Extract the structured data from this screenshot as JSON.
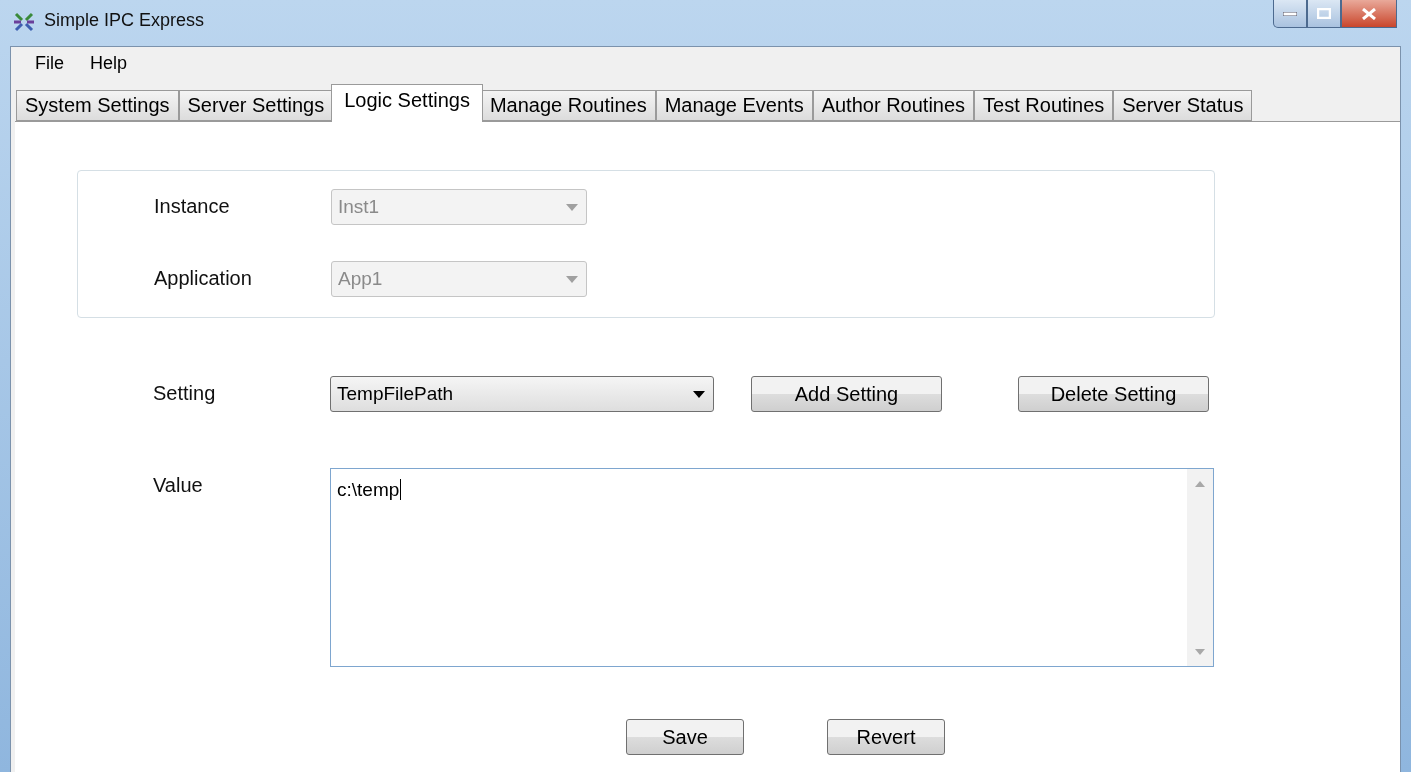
{
  "window": {
    "title": "Simple IPC Express"
  },
  "menu": [
    "File",
    "Help"
  ],
  "tabs": [
    {
      "label": "System Settings",
      "selected": false
    },
    {
      "label": "Server Settings",
      "selected": false
    },
    {
      "label": "Logic Settings",
      "selected": true
    },
    {
      "label": "Manage Routines",
      "selected": false
    },
    {
      "label": "Manage Events",
      "selected": false
    },
    {
      "label": "Author Routines",
      "selected": false
    },
    {
      "label": "Test Routines",
      "selected": false
    },
    {
      "label": "Server Status",
      "selected": false
    }
  ],
  "scope": [
    {
      "label": "Instance",
      "value": "Inst1",
      "disabled": true
    },
    {
      "label": "Application",
      "value": "App1",
      "disabled": true
    }
  ],
  "setting": {
    "label": "Setting",
    "value": "TempFilePath",
    "disabled": false
  },
  "setting_buttons": [
    "Add Setting",
    "Delete Setting"
  ],
  "value": {
    "label": "Value",
    "value": "c:\\temp"
  },
  "buttons": [
    "Save",
    "Revert"
  ]
}
